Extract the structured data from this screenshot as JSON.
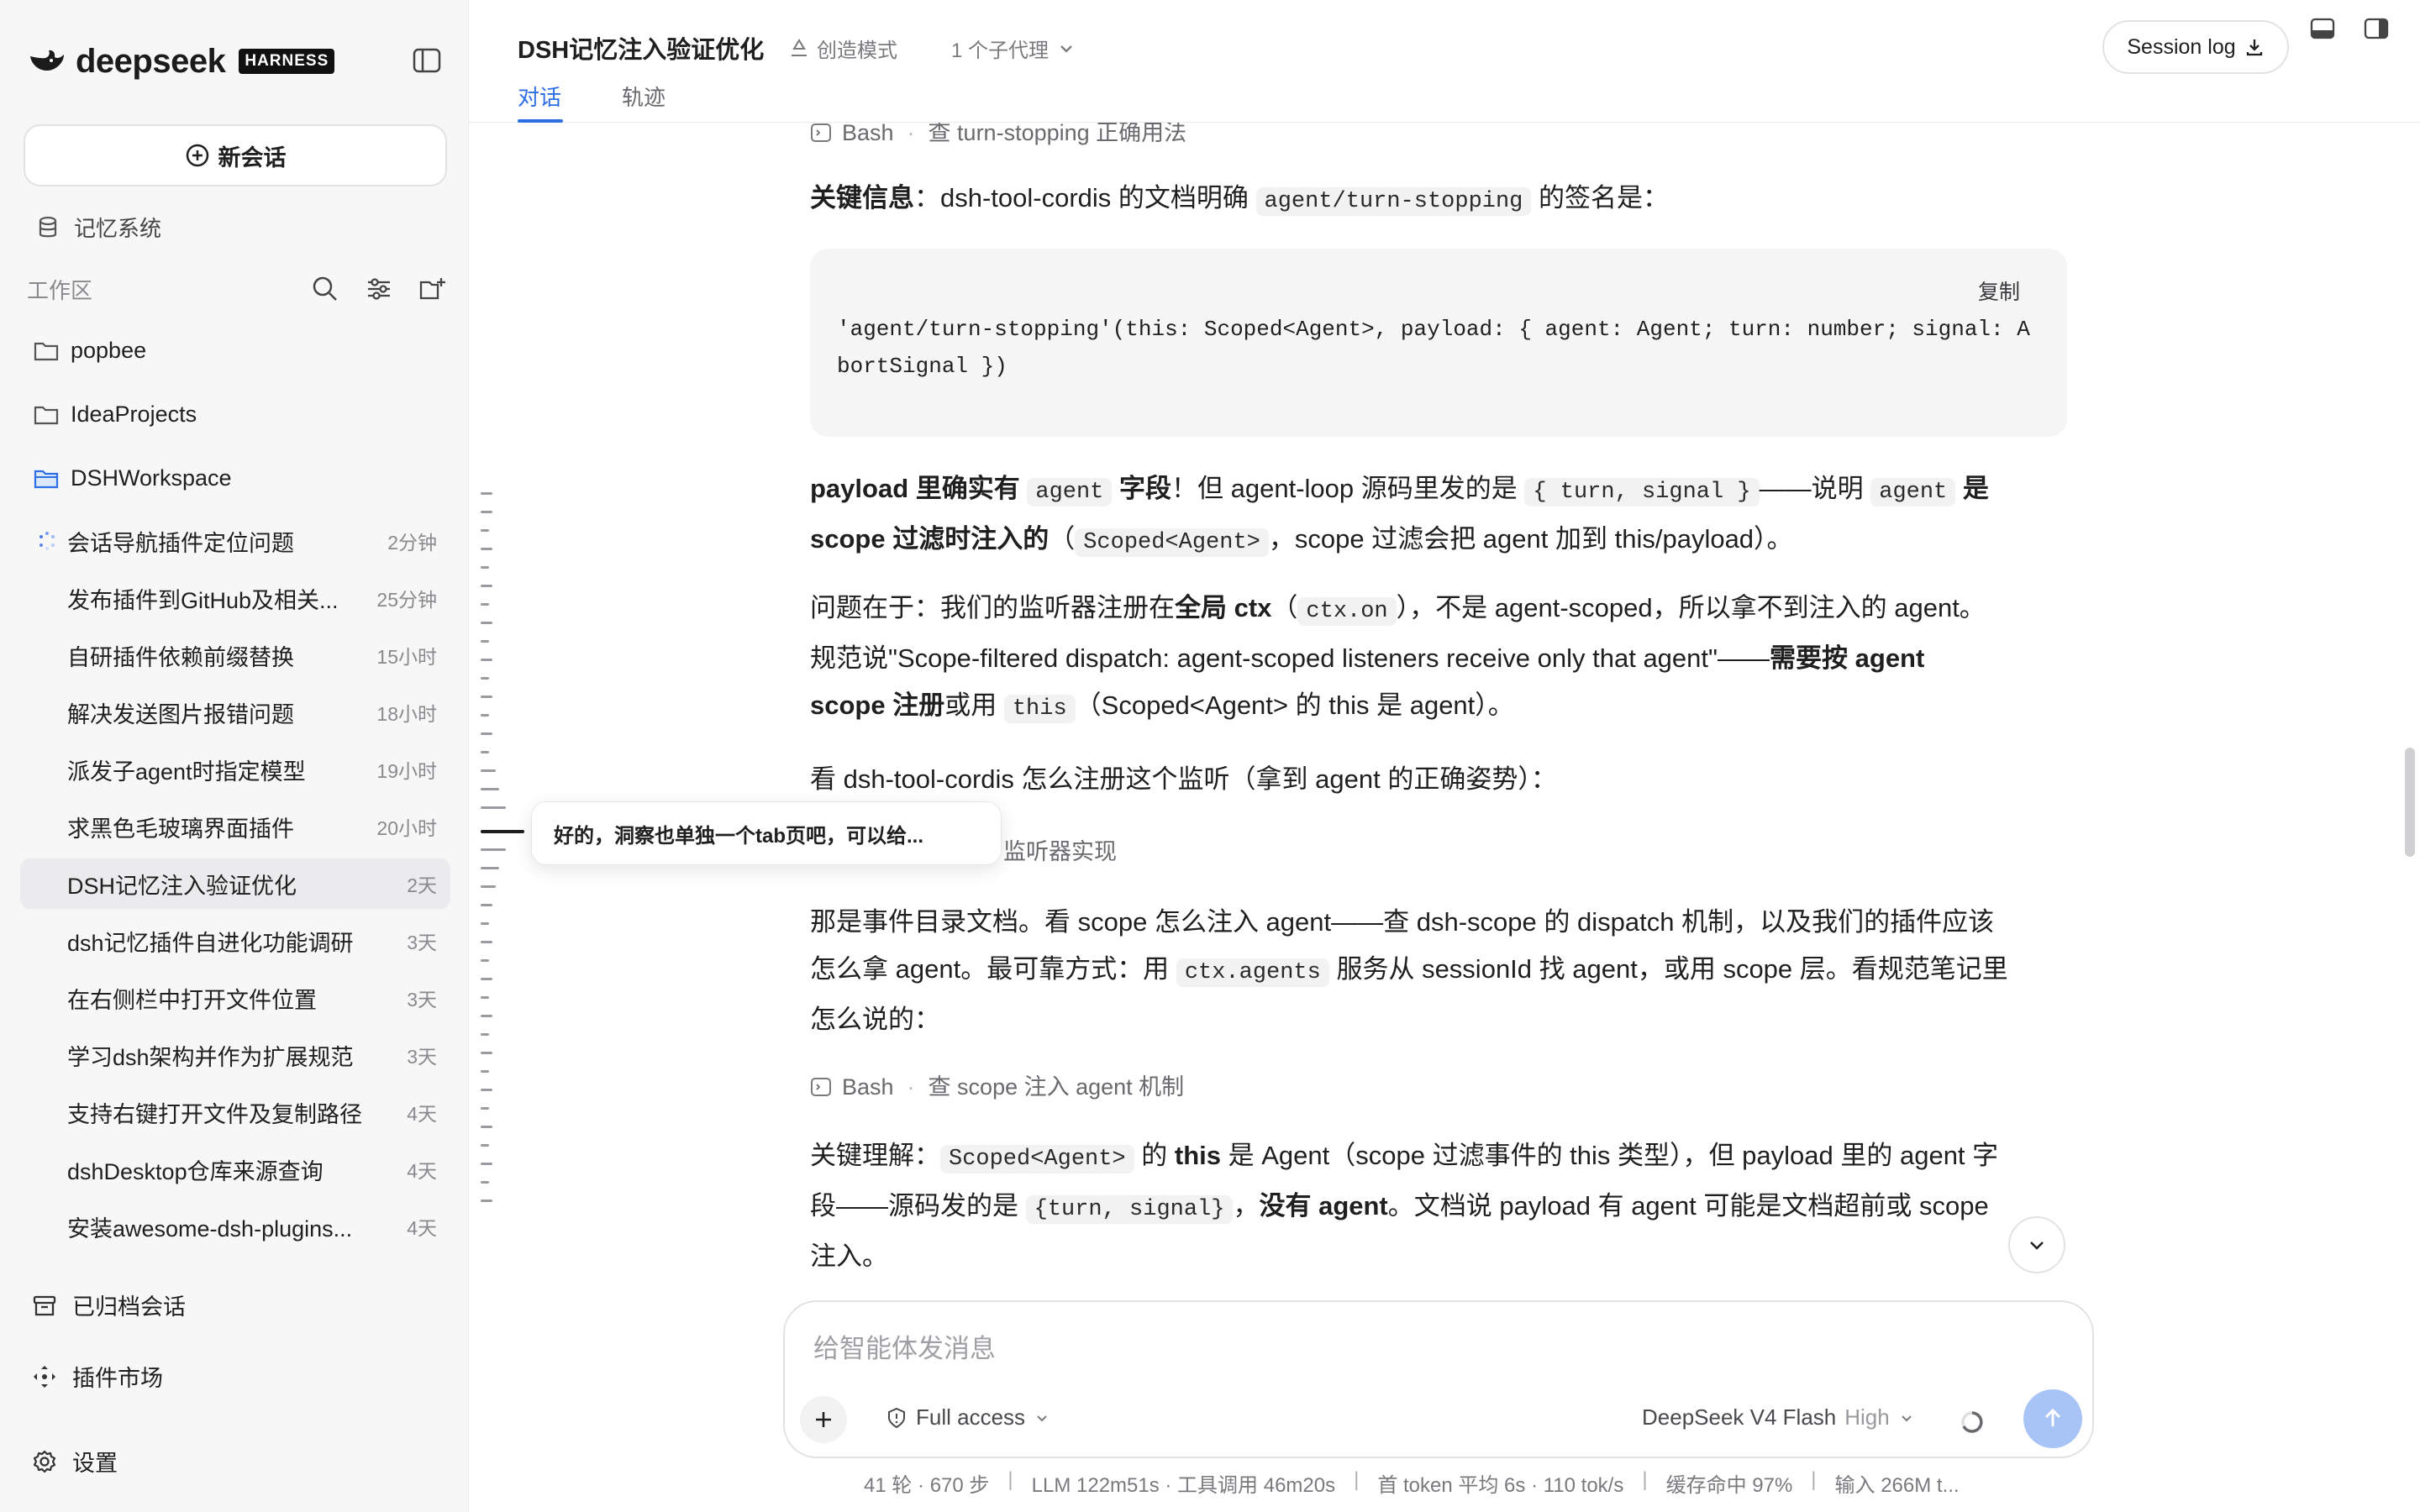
{
  "brand": {
    "name": "deepseek",
    "badge": "HARNESS"
  },
  "sidebar": {
    "new_chat": "新会话",
    "memory_system": "记忆系统",
    "workspace_label": "工作区",
    "folders": [
      "popbee",
      "IdeaProjects",
      "DSHWorkspace"
    ],
    "conversations": [
      {
        "title": "会话导航插件定位问题",
        "time": "2分钟"
      },
      {
        "title": "发布插件到GitHub及相关...",
        "time": "25分钟"
      },
      {
        "title": "自研插件依赖前缀替换",
        "time": "15小时"
      },
      {
        "title": "解决发送图片报错问题",
        "time": "18小时"
      },
      {
        "title": "派发子agent时指定模型",
        "time": "19小时"
      },
      {
        "title": "求黑色毛玻璃界面插件",
        "time": "20小时"
      },
      {
        "title": "DSH记忆注入验证优化",
        "time": "2天"
      },
      {
        "title": "dsh记忆插件自进化功能调研",
        "time": "3天"
      },
      {
        "title": "在右侧栏中打开文件位置",
        "time": "3天"
      },
      {
        "title": "学习dsh架构并作为扩展规范",
        "time": "3天"
      },
      {
        "title": "支持右键打开文件及复制路径",
        "time": "4天"
      },
      {
        "title": "dshDesktop仓库来源查询",
        "time": "4天"
      },
      {
        "title": "安装awesome-dsh-plugins...",
        "time": "4天"
      }
    ],
    "archived": "已归档会话",
    "plugin_market": "插件市场",
    "settings": "设置"
  },
  "header": {
    "title": "DSH记忆注入验证优化",
    "mode": "创造模式",
    "subagents": "1 个子代理",
    "tabs": [
      "对话",
      "轨迹"
    ],
    "session_log": "Session log"
  },
  "messages": {
    "tool1": {
      "name": "Bash",
      "desc": "查 turn-stopping 正确用法"
    },
    "p1": {
      "bold": "关键信息",
      "t1": "：dsh-tool-cordis 的文档明确 ",
      "code": "agent/turn-stopping",
      "t2": " 的签名是："
    },
    "codeblock": {
      "copy": "复制",
      "code": "'agent/turn-stopping'(this: Scoped<Agent>, payload: { agent: Agent; turn: number; signal: AbortSignal })"
    },
    "p2": {
      "b1": "payload 里确实有 ",
      "c1": "agent",
      "b2": " 字段",
      "t1": "！但 agent-loop 源码里发的是 ",
      "c2": "{ turn, signal }",
      "t2": "——说明 ",
      "c3": "agent",
      "b3": " 是",
      "b4": "scope 过滤时注入的",
      "t3": "（",
      "c4": "Scoped<Agent>",
      "t4": "，scope 过滤会把 agent 加到 this/payload）。"
    },
    "p3": {
      "t1": "问题在于：我们的监听器注册在",
      "b1": "全局 ctx",
      "t2": "（",
      "c1": "ctx.on",
      "t3": "），不是 agent-scoped，所以拿不到注入的 agent。",
      "t4": "规范说\"Scope-filtered dispatch: agent-scoped listeners receive only that agent\"——",
      "b2": "需要按 agent",
      "b3": "scope 注册",
      "t5": "或用 ",
      "c2": "this",
      "t6": "（Scoped<Agent> 的 this 是 agent）。"
    },
    "p4": "看 dsh-tool-cordis 怎么注册这个监听（拿到 agent 的正确姿势）：",
    "tool2_desc": "监听器实现",
    "p5": {
      "t1": "那是事件目录文档。看 scope 怎么注入 agent——查 dsh-scope 的 dispatch 机制，以及我们的插件应该",
      "t2": "怎么拿 agent。最可靠方式：用 ",
      "c1": "ctx.agents",
      "t3": " 服务从 sessionId 找 agent，或用 scope 层。看规范笔记里",
      "t4": "怎么说的："
    },
    "tool3": {
      "name": "Bash",
      "desc": "查 scope 注入 agent 机制"
    },
    "p6": {
      "t1": "关键理解：",
      "c1": "Scoped<Agent>",
      "t2": " 的 ",
      "b1": "this",
      "t3": " 是 Agent（scope 过滤事件的 this 类型），但 payload 里的 agent 字",
      "t4": "段——源码发的是 ",
      "c2": "{turn, signal}",
      "t5": "，",
      "b2": "没有 agent",
      "t6": "。文档说 payload 有 agent 可能是文档超前或 scope",
      "t7": "注入。"
    }
  },
  "tooltip": "好的，洞察也单独一个tab页吧，可以给...",
  "composer": {
    "placeholder": "给智能体发消息",
    "access": "Full access",
    "model": "DeepSeek V4 Flash",
    "level": "High"
  },
  "status": {
    "rounds": "41 轮 · 670 步",
    "llm": "LLM 122m51s · 工具调用 46m20s",
    "token": "首 token 平均 6s · 110 tok/s",
    "cache": "缓存命中 97%",
    "input": "输入 266M t..."
  }
}
